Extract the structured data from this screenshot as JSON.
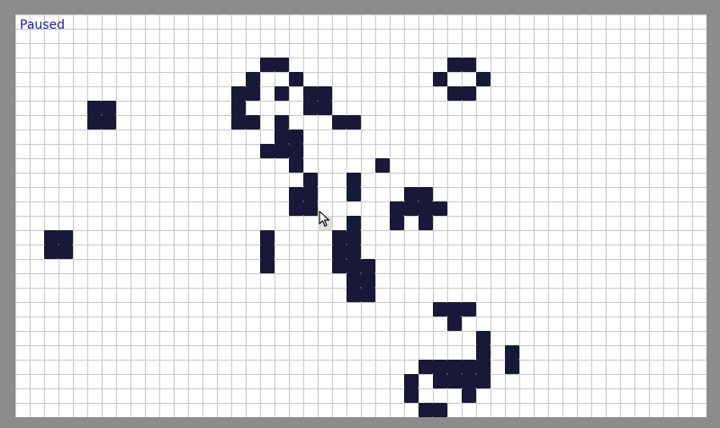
{
  "status_label": "Paused",
  "grid": {
    "cols": 48,
    "rows": 28
  },
  "colors": {
    "live_cell": "#181838",
    "status_text": "#1a1ab8",
    "grid_line": "#c9c9c9",
    "frame": "#8c8c8c",
    "hover_cell": "#e0e0e0"
  },
  "cursor_icon": "arrow-pointer-icon",
  "hover_cell": [
    21,
    14
  ],
  "live_cells": [
    [
      17,
      3
    ],
    [
      18,
      3
    ],
    [
      16,
      4
    ],
    [
      19,
      4
    ],
    [
      15,
      5
    ],
    [
      16,
      5
    ],
    [
      18,
      5
    ],
    [
      20,
      5
    ],
    [
      21,
      5
    ],
    [
      15,
      6
    ],
    [
      20,
      6
    ],
    [
      21,
      6
    ],
    [
      15,
      7
    ],
    [
      16,
      7
    ],
    [
      18,
      7
    ],
    [
      22,
      7
    ],
    [
      23,
      7
    ],
    [
      18,
      8
    ],
    [
      19,
      8
    ],
    [
      17,
      9
    ],
    [
      18,
      9
    ],
    [
      19,
      9
    ],
    [
      19,
      10
    ],
    [
      25,
      10
    ],
    [
      20,
      11
    ],
    [
      23,
      11
    ],
    [
      19,
      12
    ],
    [
      20,
      12
    ],
    [
      23,
      12
    ],
    [
      19,
      13
    ],
    [
      20,
      13
    ],
    [
      27,
      12
    ],
    [
      28,
      12
    ],
    [
      26,
      13
    ],
    [
      27,
      13
    ],
    [
      28,
      13
    ],
    [
      29,
      13
    ],
    [
      26,
      14
    ],
    [
      28,
      14
    ],
    [
      23,
      14
    ],
    [
      17,
      15
    ],
    [
      22,
      15
    ],
    [
      23,
      15
    ],
    [
      17,
      16
    ],
    [
      22,
      16
    ],
    [
      23,
      16
    ],
    [
      17,
      17
    ],
    [
      22,
      17
    ],
    [
      23,
      17
    ],
    [
      24,
      17
    ],
    [
      23,
      18
    ],
    [
      24,
      18
    ],
    [
      23,
      19
    ],
    [
      24,
      19
    ],
    [
      5,
      6
    ],
    [
      6,
      6
    ],
    [
      5,
      7
    ],
    [
      6,
      7
    ],
    [
      2,
      15
    ],
    [
      3,
      15
    ],
    [
      2,
      16
    ],
    [
      3,
      16
    ],
    [
      30,
      3
    ],
    [
      31,
      3
    ],
    [
      29,
      4
    ],
    [
      32,
      4
    ],
    [
      30,
      5
    ],
    [
      31,
      5
    ],
    [
      29,
      20
    ],
    [
      30,
      20
    ],
    [
      31,
      20
    ],
    [
      30,
      21
    ],
    [
      32,
      22
    ],
    [
      32,
      23
    ],
    [
      34,
      23
    ],
    [
      28,
      24
    ],
    [
      29,
      24
    ],
    [
      30,
      24
    ],
    [
      31,
      24
    ],
    [
      32,
      24
    ],
    [
      34,
      24
    ],
    [
      27,
      25
    ],
    [
      29,
      25
    ],
    [
      30,
      25
    ],
    [
      31,
      25
    ],
    [
      32,
      25
    ],
    [
      27,
      26
    ],
    [
      31,
      26
    ],
    [
      28,
      27
    ],
    [
      29,
      27
    ]
  ]
}
